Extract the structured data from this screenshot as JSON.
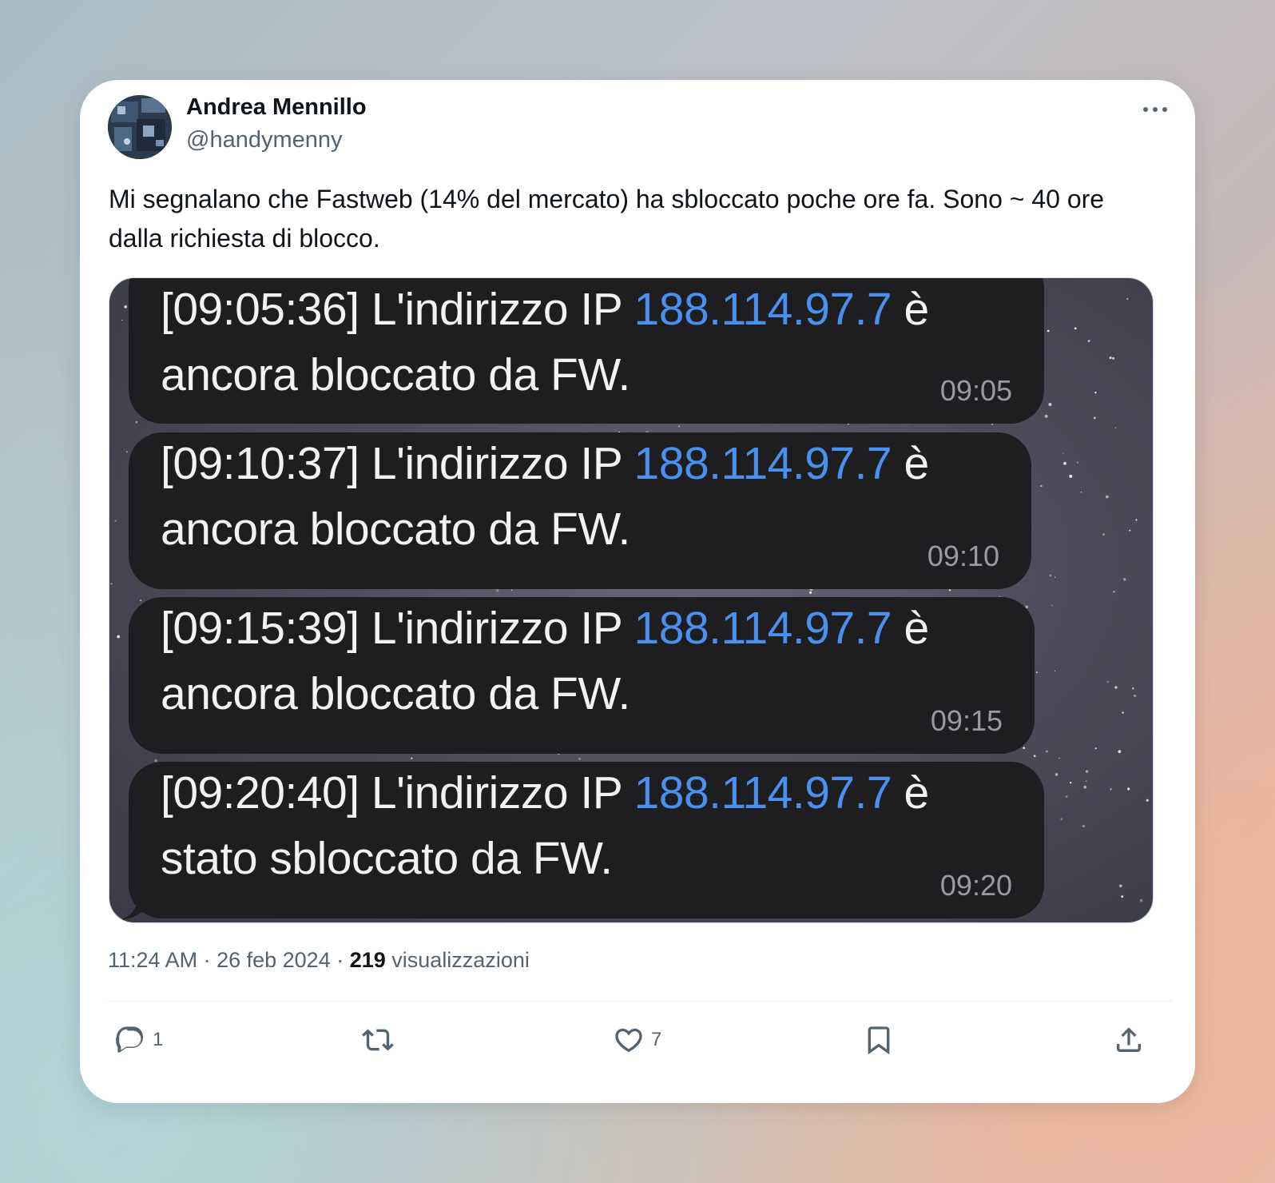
{
  "author": {
    "name": "Andrea Mennillo",
    "handle": "@handymenny"
  },
  "tweet": {
    "text": "Mi segnalano che Fastweb (14% del mercato) ha sbloccato poche ore fa. Sono ~ 40 ore dalla richiesta di blocco."
  },
  "media": {
    "messages": [
      {
        "prefix": "[09:05:36] L'indirizzo IP ",
        "ip": "188.114.97.7",
        "suffix": " è",
        "line2": "ancora bloccato da FW.",
        "time": "09:05"
      },
      {
        "prefix": "[09:10:37] L'indirizzo IP ",
        "ip": "188.114.97.7",
        "suffix": " è",
        "line2": "ancora bloccato da FW.",
        "time": "09:10"
      },
      {
        "prefix": "[09:15:39] L'indirizzo IP ",
        "ip": "188.114.97.7",
        "suffix": " è",
        "line2": "ancora bloccato da FW.",
        "time": "09:15"
      },
      {
        "prefix": "[09:20:40] L'indirizzo IP ",
        "ip": "188.114.97.7",
        "suffix": " è",
        "line2": "stato sbloccato da FW.",
        "time": "09:20"
      }
    ]
  },
  "meta": {
    "time": "11:24 AM",
    "separator": " · ",
    "date": "26 feb 2024",
    "views_count": "219",
    "views_label": " visualizzazioni"
  },
  "actions": {
    "reply_count": "1",
    "retweet_count": "",
    "like_count": "7"
  },
  "icons": {
    "more": "more-horizontal-icon",
    "reply": "reply-icon",
    "retweet": "retweet-icon",
    "like": "heart-icon",
    "bookmark": "bookmark-icon",
    "share": "share-icon"
  },
  "colors": {
    "ip_link": "#4a90ef",
    "bubble_bg": "#1e1e20",
    "text_primary": "#0f1419",
    "text_secondary": "#536471"
  }
}
